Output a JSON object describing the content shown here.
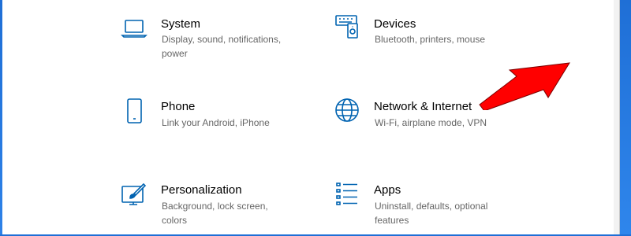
{
  "settings": {
    "tiles": [
      {
        "id": "system",
        "icon": "laptop-icon",
        "title": "System",
        "desc": "Display, sound, notifications, power"
      },
      {
        "id": "devices",
        "icon": "keyboard-icon",
        "title": "Devices",
        "desc": "Bluetooth, printers, mouse"
      },
      {
        "id": "phone",
        "icon": "phone-icon",
        "title": "Phone",
        "desc": "Link your Android, iPhone"
      },
      {
        "id": "network",
        "icon": "globe-icon",
        "title": "Network & Internet",
        "desc": "Wi-Fi, airplane mode, VPN"
      },
      {
        "id": "personalization",
        "icon": "paintbrush-icon",
        "title": "Personalization",
        "desc": "Background, lock screen, colors"
      },
      {
        "id": "apps",
        "icon": "apps-list-icon",
        "title": "Apps",
        "desc": "Uninstall, defaults, optional features"
      }
    ]
  },
  "annotation": {
    "type": "red-arrow-icon",
    "points_to": "Network & Internet",
    "color": "#ff0000"
  },
  "colors": {
    "accent": "#0063b1",
    "frame": "#1f6fd6",
    "title": "#000000",
    "desc": "#666666"
  }
}
